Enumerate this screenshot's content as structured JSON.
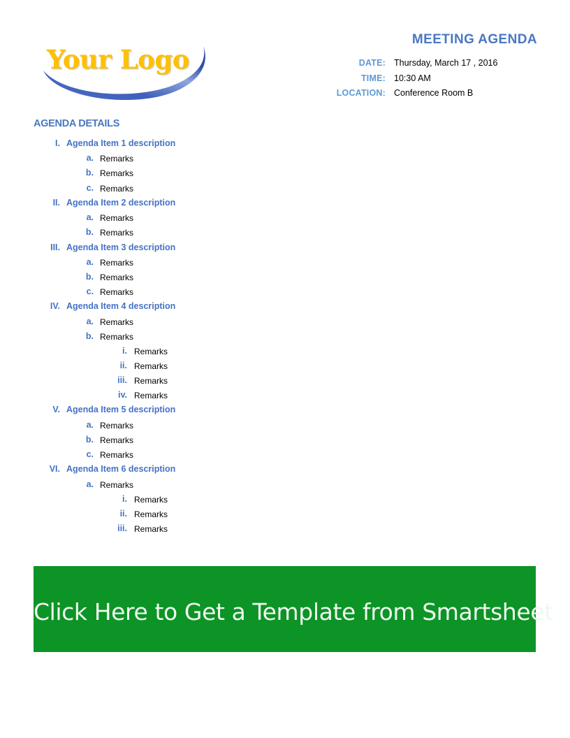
{
  "logo": {
    "text": "Your Logo",
    "text_color": "#FFC000",
    "swoosh_color_dark": "#2E4C9E",
    "swoosh_color_light": "#A8BCE4"
  },
  "header": {
    "title": "MEETING AGENDA",
    "title_color": "#4A78C2",
    "label_color": "#5B9BD5",
    "fields": [
      {
        "label": "DATE:",
        "value": "Thursday, March 17 , 2016"
      },
      {
        "label": "TIME:",
        "value": "10:30 AM"
      },
      {
        "label": "LOCATION:",
        "value": "Conference Room B"
      }
    ]
  },
  "agenda": {
    "section_title": "AGENDA DETAILS",
    "accent_color": "#4472C4",
    "rows": [
      {
        "level": 1,
        "marker": "I.",
        "label": "Agenda Item 1 description"
      },
      {
        "level": 2,
        "marker": "a.",
        "label": "Remarks"
      },
      {
        "level": 2,
        "marker": "b.",
        "label": "Remarks"
      },
      {
        "level": 2,
        "marker": "c.",
        "label": "Remarks"
      },
      {
        "level": 1,
        "marker": "II.",
        "label": "Agenda Item 2 description"
      },
      {
        "level": 2,
        "marker": "a.",
        "label": "Remarks"
      },
      {
        "level": 2,
        "marker": "b.",
        "label": "Remarks"
      },
      {
        "level": 1,
        "marker": "III.",
        "label": "Agenda Item 3 description"
      },
      {
        "level": 2,
        "marker": "a.",
        "label": "Remarks"
      },
      {
        "level": 2,
        "marker": "b.",
        "label": "Remarks"
      },
      {
        "level": 2,
        "marker": "c.",
        "label": "Remarks"
      },
      {
        "level": 1,
        "marker": "IV.",
        "label": "Agenda Item 4 description"
      },
      {
        "level": 2,
        "marker": "a.",
        "label": "Remarks"
      },
      {
        "level": 2,
        "marker": "b.",
        "label": "Remarks"
      },
      {
        "level": 3,
        "marker": "i.",
        "label": "Remarks"
      },
      {
        "level": 3,
        "marker": "ii.",
        "label": "Remarks"
      },
      {
        "level": 3,
        "marker": "iii.",
        "label": "Remarks"
      },
      {
        "level": 3,
        "marker": "iv.",
        "label": "Remarks"
      },
      {
        "level": 1,
        "marker": "V.",
        "label": "Agenda Item 5 description"
      },
      {
        "level": 2,
        "marker": "a.",
        "label": "Remarks"
      },
      {
        "level": 2,
        "marker": "b.",
        "label": "Remarks"
      },
      {
        "level": 2,
        "marker": "c.",
        "label": "Remarks"
      },
      {
        "level": 1,
        "marker": "VI.",
        "label": "Agenda Item 6 description"
      },
      {
        "level": 2,
        "marker": "a.",
        "label": "Remarks"
      },
      {
        "level": 3,
        "marker": "i.",
        "label": "Remarks"
      },
      {
        "level": 3,
        "marker": "ii.",
        "label": "Remarks"
      },
      {
        "level": 3,
        "marker": "iii.",
        "label": "Remarks"
      }
    ]
  },
  "cta": {
    "text": "Click Here to Get a Template from Smartsheet",
    "background_color": "#0C9426",
    "text_color": "#EFF7EF"
  }
}
